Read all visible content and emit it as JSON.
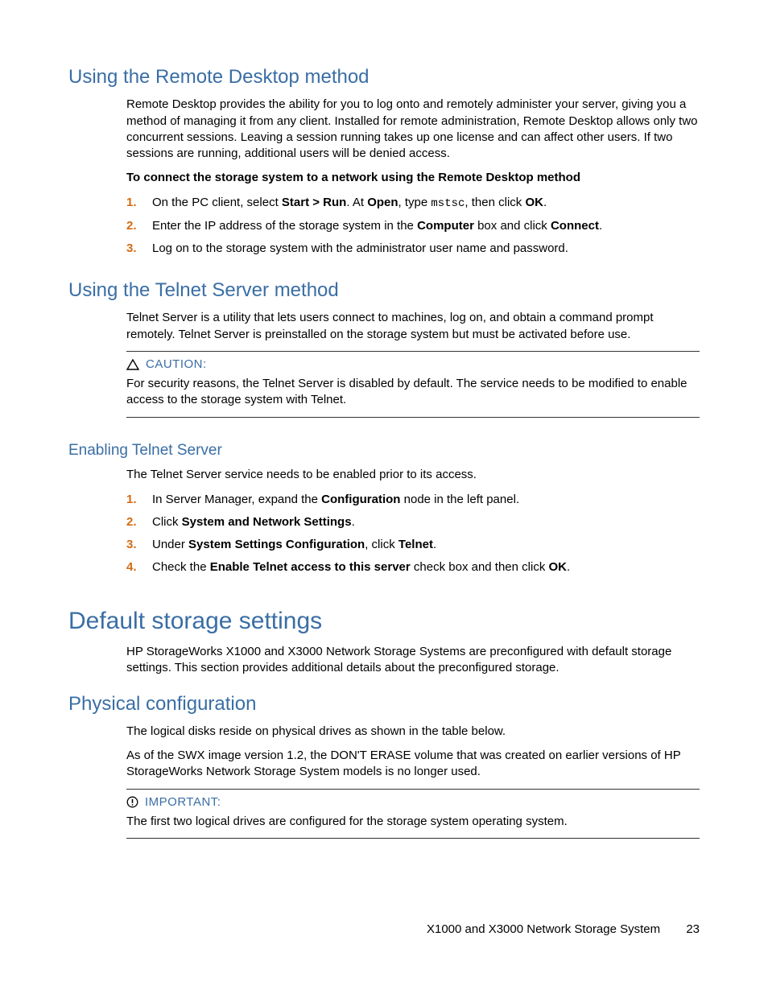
{
  "s1": {
    "heading": "Using the Remote Desktop method",
    "intro": "Remote Desktop provides the ability for you to log onto and remotely administer your server, giving you a method of managing it from any client. Installed for remote administration, Remote Desktop allows only two concurrent sessions. Leaving a session running takes up one license and can affect other users. If two sessions are running, additional users will be denied access.",
    "task_label": "To connect the storage system to a network using the Remote Desktop method",
    "steps": {
      "s1_pre": "On the PC client, select ",
      "s1_b1": "Start > Run",
      "s1_mid1": ". At ",
      "s1_b2": "Open",
      "s1_mid2": ", type ",
      "s1_code": "mstsc",
      "s1_mid3": ", then click ",
      "s1_b3": "OK",
      "s1_post": ".",
      "s2_pre": "Enter the IP address of the storage system in the ",
      "s2_b1": "Computer",
      "s2_mid": " box and click ",
      "s2_b2": "Connect",
      "s2_post": ".",
      "s3": "Log on to the storage system with the administrator user name and password."
    }
  },
  "s2": {
    "heading": "Using the Telnet Server method",
    "intro": "Telnet Server is a utility that lets users connect to machines, log on, and obtain a command prompt remotely. Telnet Server is preinstalled on the storage system but must be activated before use.",
    "caution_label": "CAUTION:",
    "caution_body": "For security reasons, the Telnet Server is disabled by default. The service needs to be modified to enable access to the storage system with Telnet."
  },
  "s3": {
    "heading": "Enabling Telnet Server",
    "intro": "The Telnet Server service needs to be enabled prior to its access.",
    "steps": {
      "s1_pre": "In Server Manager, expand the ",
      "s1_b1": "Configuration",
      "s1_post": " node in the left panel.",
      "s2_pre": "Click ",
      "s2_b1": "System and Network Settings",
      "s2_post": ".",
      "s3_pre": "Under ",
      "s3_b1": "System Settings Configuration",
      "s3_mid": ", click ",
      "s3_b2": "Telnet",
      "s3_post": ".",
      "s4_pre": "Check the ",
      "s4_b1": "Enable Telnet access to this server",
      "s4_mid": " check box and then click ",
      "s4_b2": "OK",
      "s4_post": "."
    }
  },
  "s4": {
    "heading": "Default storage settings",
    "intro": "HP StorageWorks X1000 and X3000 Network Storage Systems are preconfigured with default storage settings. This section provides additional details about the preconfigured storage."
  },
  "s5": {
    "heading": "Physical configuration",
    "p1": "The logical disks reside on physical drives as shown in the table below.",
    "p2": "As of the SWX image version 1.2, the DON'T ERASE volume that was created on earlier versions of HP StorageWorks Network Storage System models is no longer used.",
    "important_label": "IMPORTANT:",
    "important_body": "The first two logical drives are configured for the storage system operating system."
  },
  "footer": {
    "title": "X1000 and X3000 Network Storage System",
    "page": "23"
  }
}
